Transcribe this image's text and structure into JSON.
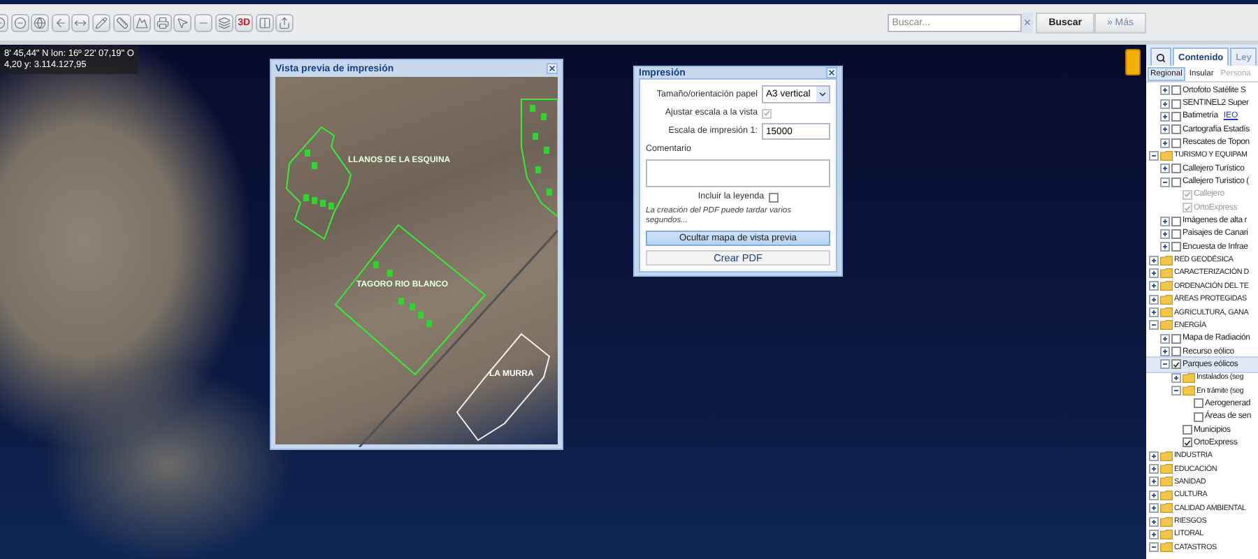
{
  "toolbar": {
    "buttons": [
      {
        "kind": "zoom-in"
      },
      {
        "kind": "zoom-out"
      },
      {
        "kind": "globe"
      },
      {
        "kind": "back"
      },
      {
        "kind": "pan"
      },
      {
        "kind": "pencil"
      },
      {
        "kind": "ruler"
      },
      {
        "kind": "terrain"
      },
      {
        "kind": "print"
      },
      {
        "kind": "select"
      },
      {
        "kind": "line"
      },
      {
        "kind": "layers"
      },
      {
        "kind": "label",
        "label": "3D"
      },
      {
        "kind": "columns"
      },
      {
        "kind": "export"
      }
    ]
  },
  "search": {
    "placeholder": "Buscar...",
    "button": "Buscar",
    "more": "» Más"
  },
  "coordinates": {
    "line_1": "8' 45,44\" N  lon: 16º 22' 07,19\" O",
    "line_2": "4,20  y: 3.114.127,95"
  },
  "preview": {
    "title": "Vista previa de impresión",
    "labels": [
      {
        "text": "LLANOS DE LA ESQUINA",
        "color": "#e8ffe0"
      },
      {
        "text": "TAGORO RIO BLANCO",
        "color": "#e8ffe0"
      },
      {
        "text": "LA MURRA",
        "color": "#ffffff"
      }
    ]
  },
  "print_dialog": {
    "title": "Impresión",
    "paper_label": "Tamaño/orientación papel",
    "paper_value": "A3 vertical",
    "fit_label": "Ajustar escala a la vista",
    "fit_checked": true,
    "fit_disabled": true,
    "scale_label": "Escala de impresión 1:",
    "scale_value": "15000",
    "comment_label": "Comentario",
    "legend_label": "Incluir la leyenda",
    "legend_checked": false,
    "note": "La creación del PDF puede tardar varios segundos...",
    "buttons": [
      {
        "label": "Ocultar mapa de vista previa",
        "pressed": true
      },
      {
        "label": "Crear PDF",
        "pressed": false
      }
    ]
  },
  "panel": {
    "tabs": [
      {
        "kind": "search",
        "selected": false
      },
      {
        "kind": "text",
        "label": "Contenido",
        "selected": true
      },
      {
        "kind": "text",
        "label": "Ley",
        "selected": false
      }
    ],
    "subtabs": [
      {
        "label": "Regional",
        "selected": true,
        "disabled": false
      },
      {
        "label": "Insular",
        "selected": false,
        "disabled": false
      },
      {
        "label": "Persona",
        "selected": false,
        "disabled": true
      }
    ],
    "continued_items": [
      {
        "kind": "layer",
        "label": "Ortofoto Satélite S",
        "expanded": false,
        "checked": false
      },
      {
        "kind": "layer",
        "label": "SENTINEL2 Super",
        "expanded": false,
        "checked": false
      },
      {
        "kind": "layer",
        "label": "Batimetría",
        "link": "IEO",
        "expanded": false,
        "checked": false
      },
      {
        "kind": "layer",
        "label": "Cartografía Estadís",
        "expanded": false,
        "checked": false
      },
      {
        "kind": "layer",
        "label": "Rescates de Topon",
        "expanded": false,
        "checked": false
      }
    ],
    "items": [
      {
        "kind": "folder",
        "label": "TURISMO Y EQUIPAM",
        "expanded": true,
        "children": [
          {
            "kind": "layer",
            "label": "Callejero Turístico",
            "expanded": false,
            "checked": false
          },
          {
            "kind": "layer",
            "label": "Callejero Turístico (",
            "expanded": true,
            "checked": false,
            "children": [
              {
                "kind": "layer",
                "label": "Callejero",
                "checked": true,
                "disabled": true
              },
              {
                "kind": "layer",
                "label": "OrtoExpress",
                "checked": true,
                "disabled": true
              }
            ]
          },
          {
            "kind": "layer",
            "label": "Imágenes de alta r",
            "expanded": false,
            "checked": false
          },
          {
            "kind": "layer",
            "label": "Paisajes de Canari",
            "expanded": false,
            "checked": false
          },
          {
            "kind": "layer",
            "label": "Encuesta de Infrae",
            "expanded": false,
            "checked": false
          }
        ]
      },
      {
        "kind": "folder",
        "label": "RED GEODÉSICA",
        "expanded": false
      },
      {
        "kind": "folder",
        "label": "CARACTERIZACIÓN D",
        "expanded": false
      },
      {
        "kind": "folder",
        "label": "ORDENACIÓN DEL TE",
        "expanded": false
      },
      {
        "kind": "folder",
        "label": "ÁREAS PROTEGIDAS",
        "expanded": false
      },
      {
        "kind": "folder",
        "label": "AGRICULTURA, GANA",
        "expanded": false
      },
      {
        "kind": "folder",
        "label": "ENERGÍA",
        "expanded": true,
        "children": [
          {
            "kind": "layer",
            "label": "Mapa de Radiación",
            "expanded": false,
            "checked": false
          },
          {
            "kind": "layer",
            "label": "Recurso eólico",
            "expanded": false,
            "checked": false
          },
          {
            "kind": "layer",
            "label": "Parques eólicos",
            "expanded": true,
            "checked": true,
            "selected": true,
            "children": [
              {
                "kind": "folder",
                "label": "Instalados (seg",
                "expanded": false
              },
              {
                "kind": "folder",
                "label": "En trámite (seg",
                "expanded": true,
                "children": [
                  {
                    "kind": "layer",
                    "label": "Aerogenerad",
                    "checked": false
                  },
                  {
                    "kind": "layer",
                    "label": "Áreas de sen",
                    "checked": false
                  }
                ]
              },
              {
                "kind": "layer",
                "label": "Municipios",
                "checked": false
              },
              {
                "kind": "layer",
                "label": "OrtoExpress",
                "checked": true
              }
            ]
          }
        ]
      },
      {
        "kind": "folder",
        "label": "INDUSTRIA",
        "expanded": false
      },
      {
        "kind": "folder",
        "label": "EDUCACIÓN",
        "expanded": false
      },
      {
        "kind": "folder",
        "label": "SANIDAD",
        "expanded": false
      },
      {
        "kind": "folder",
        "label": "CULTURA",
        "expanded": false
      },
      {
        "kind": "folder",
        "label": "CALIDAD AMBIENTAL",
        "expanded": false
      },
      {
        "kind": "folder",
        "label": "RIESGOS",
        "expanded": false
      },
      {
        "kind": "folder",
        "label": "LITORAL",
        "expanded": false
      },
      {
        "kind": "folder",
        "label": "CATASTROS",
        "expanded": true
      }
    ]
  }
}
